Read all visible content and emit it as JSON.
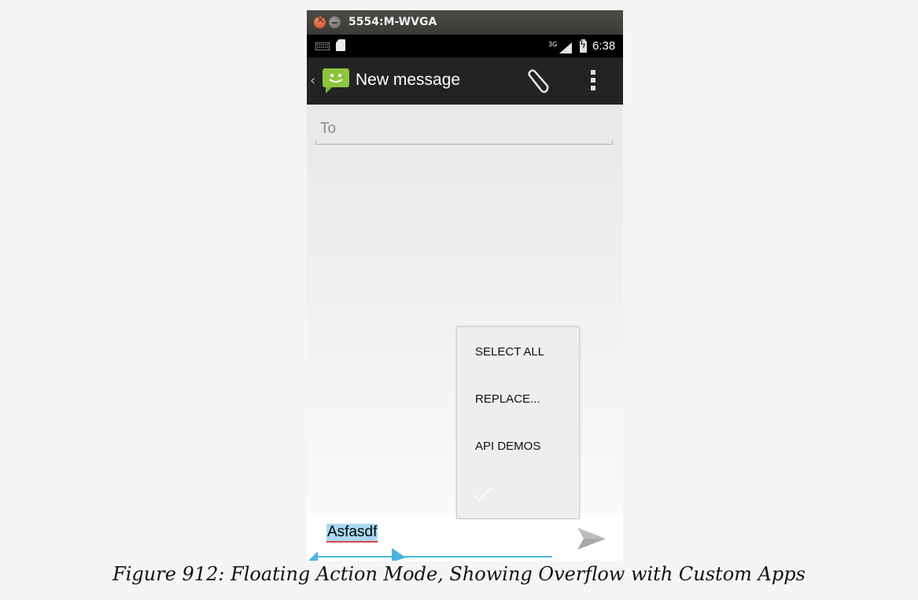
{
  "window": {
    "title": "5554:M-WVGA"
  },
  "status_bar": {
    "time": "6:38",
    "network": "3G"
  },
  "action_bar": {
    "title": "New message"
  },
  "compose": {
    "to_placeholder": "To",
    "message_text": "Asfasdf"
  },
  "floating_menu": {
    "items": [
      "SELECT ALL",
      "REPLACE...",
      "API DEMOS"
    ]
  },
  "caption": "Figure 912: Floating Action Mode, Showing Overflow with Custom Apps",
  "colors": {
    "action_bar_bg": "#232323",
    "selection_highlight": "#a9d9ef",
    "selection_handle": "#49b4e0",
    "app_icon_green": "#8cc63f"
  }
}
